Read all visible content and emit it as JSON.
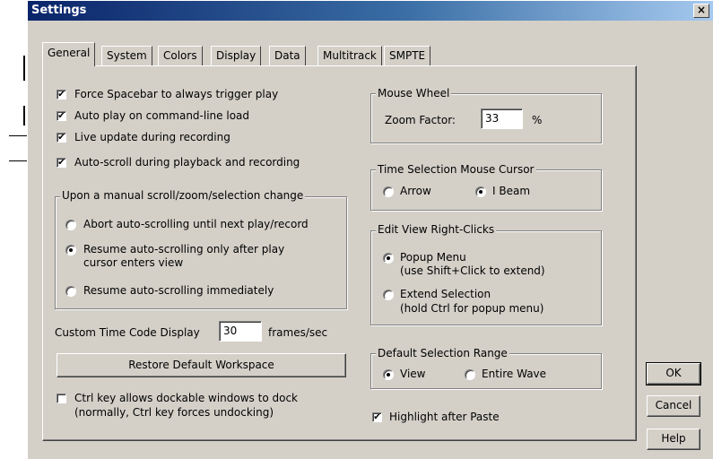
{
  "window": {
    "title": "Settings",
    "close_glyph": "×"
  },
  "tabs": [
    {
      "label": "General",
      "active": true
    },
    {
      "label": "System"
    },
    {
      "label": "Colors"
    },
    {
      "label": "Display"
    },
    {
      "label": "Data"
    },
    {
      "label": "Multitrack"
    },
    {
      "label": "SMPTE"
    }
  ],
  "options": {
    "force_spacebar": {
      "label": "Force Spacebar to always trigger play",
      "checked": true
    },
    "auto_play": {
      "label": "Auto play on command-line load",
      "checked": true
    },
    "live_update": {
      "label": "Live update during recording",
      "checked": true
    },
    "auto_scroll": {
      "label": "Auto-scroll during playback and recording",
      "checked": true
    }
  },
  "manual_scroll_group": {
    "title": "Upon a manual scroll/zoom/selection change",
    "opt1": "Abort auto-scrolling until next play/record",
    "opt2_line1": "Resume auto-scrolling only after play",
    "opt2_line2": "cursor enters view",
    "opt3": "Resume auto-scrolling immediately",
    "selected": 2
  },
  "time_code": {
    "label": "Custom Time Code Display",
    "value": "30",
    "unit": "frames/sec"
  },
  "restore_button": "Restore Default Workspace",
  "ctrl_key": {
    "line1": "Ctrl key allows dockable windows to dock",
    "line2": "(normally, Ctrl key forces undocking)",
    "checked": false
  },
  "mouse_wheel": {
    "title": "Mouse Wheel",
    "zoom_label": "Zoom Factor:",
    "zoom_value": "33",
    "unit": "%"
  },
  "time_selection": {
    "title": "Time Selection Mouse Cursor",
    "opt1": "Arrow",
    "opt2": "I Beam",
    "selected": 2
  },
  "edit_view": {
    "title": "Edit View Right-Clicks",
    "opt1_line1": "Popup Menu",
    "opt1_line2": "(use Shift+Click to extend)",
    "opt2_line1": "Extend Selection",
    "opt2_line2": "(hold Ctrl for popup menu)",
    "selected": 1
  },
  "default_selection": {
    "title": "Default Selection Range",
    "opt1": "View",
    "opt2": "Entire Wave",
    "selected": 1
  },
  "highlight": {
    "label": "Highlight after Paste",
    "checked": true
  },
  "buttons": {
    "ok": "OK",
    "cancel": "Cancel",
    "help": "Help"
  },
  "check_glyph": "✔",
  "colors": {
    "title_start": "#0a246a",
    "face": "#d4d0c8"
  }
}
